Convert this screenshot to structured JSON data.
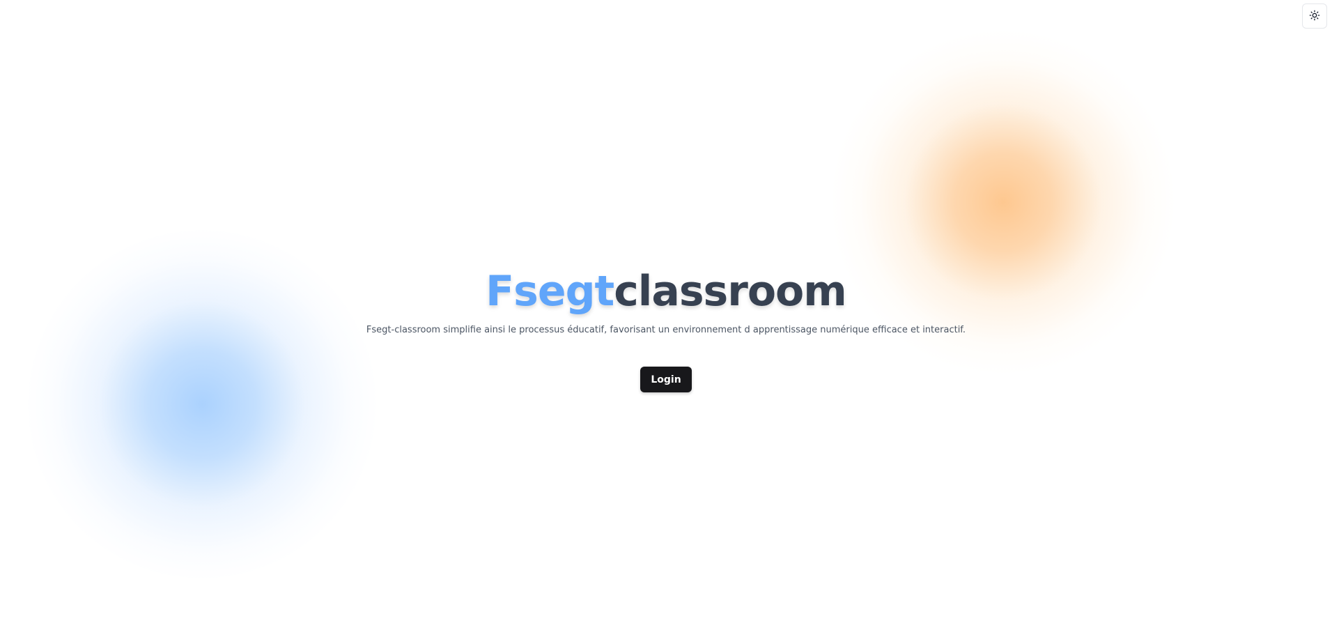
{
  "theme_toggle": {
    "icon": "sun-icon"
  },
  "hero": {
    "title_brand": "Fsegt",
    "title_rest": "classroom",
    "subtitle": "Fsegt-classroom simplifie ainsi le processus éducatif, favorisant un environnement d apprentissage numérique efficace et interactif.",
    "login_label": "Login"
  },
  "colors": {
    "brand_blue": "#60a5fa",
    "title_dark": "#374151",
    "button_bg": "#18181b",
    "blob_blue": "#93c5fd",
    "blob_orange": "#fdba74"
  }
}
